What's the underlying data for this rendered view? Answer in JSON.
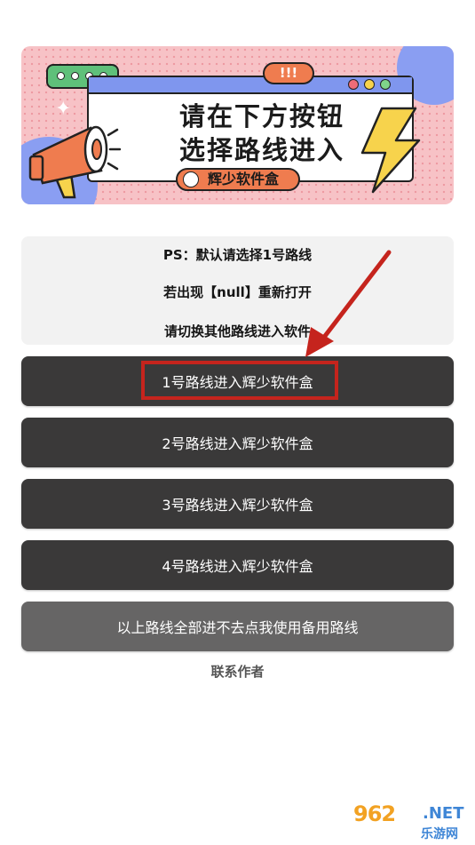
{
  "banner": {
    "title_line1": "请在下方按钮",
    "title_line2": "选择路线进入",
    "exclaim": "!!!",
    "brand": "辉少软件盒"
  },
  "info": {
    "line1": "PS：默认请选择1号路线",
    "line2": "若出现【null】重新打开",
    "line3": "请切换其他路线进入软件"
  },
  "routes": [
    {
      "label": "1号路线进入辉少软件盒"
    },
    {
      "label": "2号路线进入辉少软件盒"
    },
    {
      "label": "3号路线进入辉少软件盒"
    },
    {
      "label": "4号路线进入辉少软件盒"
    }
  ],
  "backup_route": {
    "label": "以上路线全部进不去点我使用备用路线"
  },
  "contact": {
    "label": "联系作者"
  },
  "watermark": {
    "num": "962",
    "net": ".NET",
    "cn": "乐游网"
  },
  "colors": {
    "button_dark": "#3a3939",
    "button_backup": "#666565",
    "highlight_red": "#c5241d",
    "banner_pink": "#f7c2c6",
    "banner_blue": "#8a9ef2"
  }
}
